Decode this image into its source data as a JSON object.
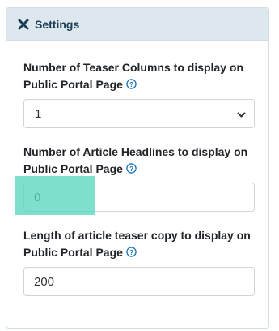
{
  "header": {
    "title": "Settings",
    "icon": "close-x-icon",
    "color": "#1d3d56",
    "background": "#dde7ee"
  },
  "fields": [
    {
      "label": "Number of Teaser Columns to display on Public Portal Page",
      "type": "select",
      "value": "1"
    },
    {
      "label": "Number of Article Headlines to display on Public Portal Page",
      "type": "input",
      "value": "0"
    },
    {
      "label": "Length of article teaser copy to display on Public Portal Page",
      "type": "input",
      "value": "200"
    }
  ],
  "accent": "#1a73b5",
  "highlight_color": "#5ad6bf"
}
